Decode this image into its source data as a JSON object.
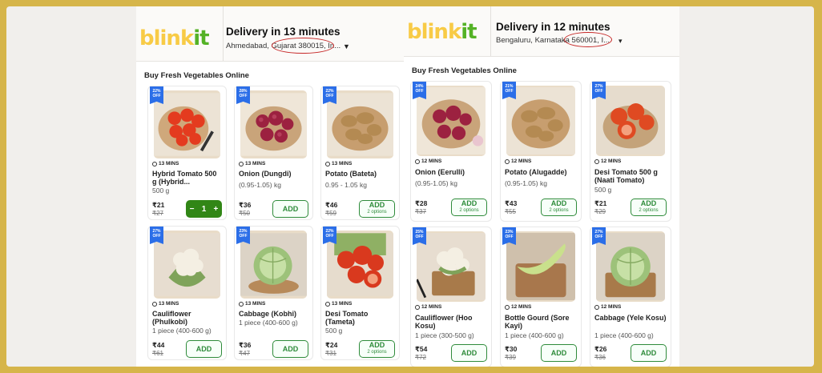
{
  "left": {
    "logo": {
      "part1": "blink",
      "part2": "it"
    },
    "delivery": "Delivery in 13 minutes",
    "address": "Ahmedabad, Gujarat 380015, In...",
    "section_title": "Buy Fresh Vegetables Online",
    "products": [
      {
        "badge": "22% OFF",
        "eta": "13 MINS",
        "name": "Hybrid Tomato 500 g (Hybrid...",
        "qty": "500 g",
        "price": "₹21",
        "mrp": "₹27",
        "stepper": {
          "minus": "−",
          "count": "1",
          "plus": "+"
        },
        "image": "tomato"
      },
      {
        "badge": "28% OFF",
        "eta": "13 MINS",
        "name": "Onion (Dungdi)",
        "qty": "(0.95-1.05) kg",
        "price": "₹36",
        "mrp": "₹50",
        "add": "ADD",
        "image": "onion"
      },
      {
        "badge": "22% OFF",
        "eta": "13 MINS",
        "name": "Potato (Bateta)",
        "qty": "0.95 - 1.05 kg",
        "price": "₹46",
        "mrp": "₹59",
        "add": "ADD",
        "options": "2 options",
        "image": "potato"
      },
      {
        "badge": "27% OFF",
        "eta": "13 MINS",
        "name": "Cauliflower (Phulkobi)",
        "qty": "1 piece (400-600 g)",
        "price": "₹44",
        "mrp": "₹61",
        "add": "ADD",
        "image": "cauliflower"
      },
      {
        "badge": "23% OFF",
        "eta": "13 MINS",
        "name": "Cabbage (Kobhi)",
        "qty": "1 piece (400-600 g)",
        "price": "₹36",
        "mrp": "₹47",
        "add": "ADD",
        "image": "cabbage"
      },
      {
        "badge": "22% OFF",
        "eta": "13 MINS",
        "name": "Desi Tomato (Tameta)",
        "qty": "500 g",
        "price": "₹24",
        "mrp": "₹31",
        "add": "ADD",
        "options": "2 options",
        "image": "desitomato"
      }
    ]
  },
  "right": {
    "logo": {
      "part1": "blink",
      "part2": "it"
    },
    "delivery": "Delivery in 12 minutes",
    "address": "Bengaluru, Karnataka 560001, I...",
    "section_title": "Buy Fresh Vegetables Online",
    "products": [
      {
        "badge": "24% OFF",
        "eta": "12 MINS",
        "name": "Onion (Eerulli)",
        "qty": "(0.95-1.05) kg",
        "price": "₹28",
        "mrp": "₹37",
        "add": "ADD",
        "options": "2 options",
        "image": "onion"
      },
      {
        "badge": "21% OFF",
        "eta": "12 MINS",
        "name": "Potato (Alugadde)",
        "qty": "(0.95-1.05) kg",
        "price": "₹43",
        "mrp": "₹55",
        "add": "ADD",
        "options": "2 options",
        "image": "potato"
      },
      {
        "badge": "27% OFF",
        "eta": "12 MINS",
        "name": "Desi Tomato 500 g (Naati Tomato)",
        "qty": "500 g",
        "price": "₹21",
        "mrp": "₹29",
        "add": "ADD",
        "options": "2 options",
        "image": "desitomato"
      },
      {
        "badge": "25% OFF",
        "eta": "12 MINS",
        "name": "Cauliflower (Hoo Kosu)",
        "qty": "1 piece (300-500 g)",
        "price": "₹54",
        "mrp": "₹72",
        "add": "ADD",
        "image": "cauliflower"
      },
      {
        "badge": "23% OFF",
        "eta": "12 MINS",
        "name": "Bottle Gourd (Sore Kayi)",
        "qty": "1 piece (400-600 g)",
        "price": "₹30",
        "mrp": "₹39",
        "add": "ADD",
        "image": "gourd"
      },
      {
        "badge": "27% OFF",
        "eta": "12 MINS",
        "name": "Cabbage (Yele Kosu)",
        "qty": "1 piece (400-600 g)",
        "price": "₹26",
        "mrp": "₹36",
        "add": "ADD",
        "image": "cabbage"
      }
    ]
  },
  "colors": {
    "page_bg": "#d6b54a",
    "accent_green": "#318616",
    "badge_blue": "#2b6ee8",
    "logo_yellow": "#f8cb46",
    "logo_green": "#54b226",
    "annotation_red": "#c62828"
  }
}
